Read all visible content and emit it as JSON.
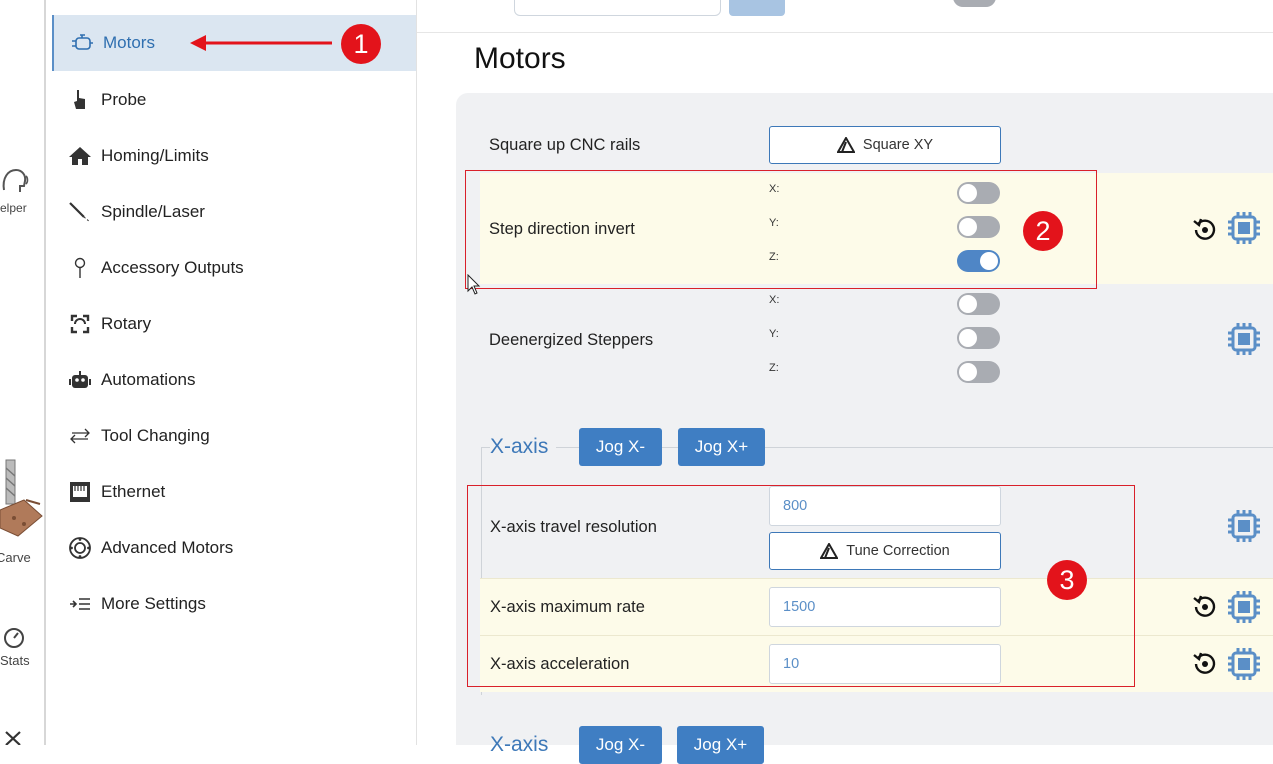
{
  "rail": {
    "helper_label": "elper",
    "carve_label": "Carve",
    "stats_label": "Stats"
  },
  "sidebar": {
    "items": [
      {
        "label": "Motors",
        "icon": "motor-icon",
        "active": true
      },
      {
        "label": "Probe",
        "icon": "probe-icon"
      },
      {
        "label": "Homing/Limits",
        "icon": "home-icon"
      },
      {
        "label": "Spindle/Laser",
        "icon": "spindle-icon"
      },
      {
        "label": "Accessory Outputs",
        "icon": "pin-icon"
      },
      {
        "label": "Rotary",
        "icon": "rotary-icon"
      },
      {
        "label": "Automations",
        "icon": "robot-icon"
      },
      {
        "label": "Tool Changing",
        "icon": "swap-icon"
      },
      {
        "label": "Ethernet",
        "icon": "ethernet-icon"
      },
      {
        "label": "Advanced Motors",
        "icon": "gear-circle-icon"
      },
      {
        "label": "More Settings",
        "icon": "indent-icon"
      }
    ]
  },
  "main": {
    "title": "Motors",
    "square_up": {
      "label": "Square up CNC rails",
      "button": "Square XY"
    },
    "step_invert": {
      "label": "Step direction invert",
      "axes": [
        "X:",
        "Y:",
        "Z:"
      ],
      "values": [
        false,
        false,
        true
      ]
    },
    "deenergized": {
      "label": "Deenergized Steppers",
      "axes": [
        "X:",
        "Y:",
        "Z:"
      ],
      "values": [
        false,
        false,
        false
      ]
    },
    "x_axis": {
      "title": "X-axis",
      "jog_minus": "Jog X-",
      "jog_plus": "Jog X+",
      "travel_label": "X-axis travel resolution",
      "travel_value": "800",
      "tune_button": "Tune Correction",
      "max_rate_label": "X-axis maximum rate",
      "max_rate_value": "1500",
      "accel_label": "X-axis acceleration",
      "accel_value": "10"
    },
    "next_section": {
      "title": "X-axis",
      "jog_minus": "Jog X-",
      "jog_plus": "Jog X+"
    }
  },
  "annotations": {
    "badge1": "1",
    "badge2": "2",
    "badge3": "3"
  },
  "colors": {
    "accent": "#3f7ec3",
    "annotation": "#e3131b",
    "highlight_row": "#fdfbe9"
  }
}
